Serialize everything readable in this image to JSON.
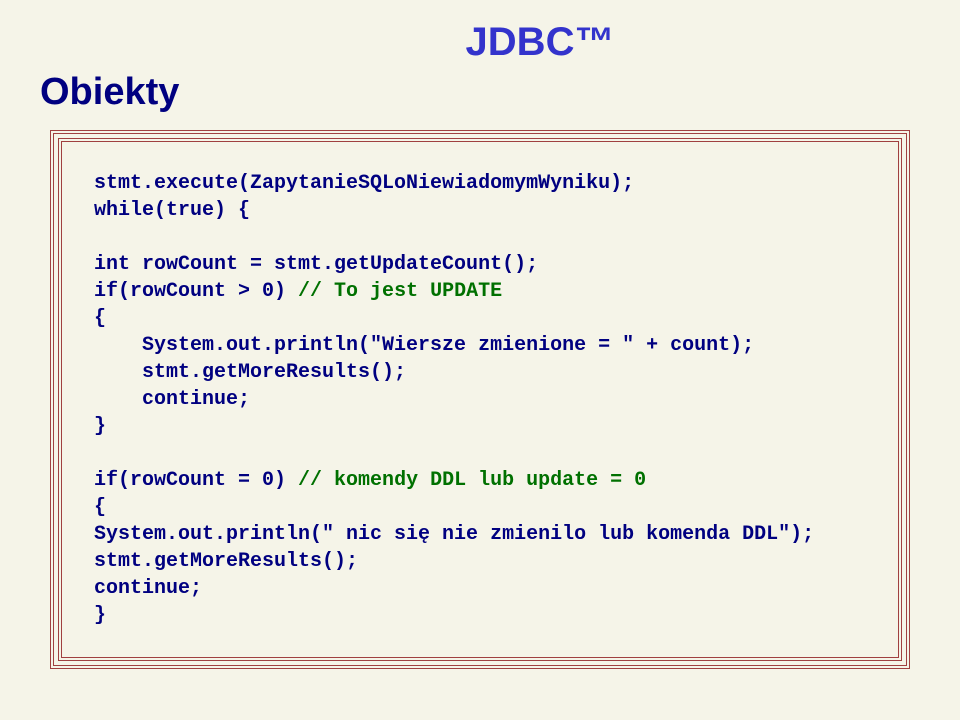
{
  "header": {
    "title": "JDBC™"
  },
  "section": {
    "title": "Obiekty"
  },
  "code": {
    "l1": "stmt.execute(ZapytanieSQLoNiewiadomymWyniku);",
    "l2": "while(true) {",
    "l3": "",
    "l4": "int rowCount = stmt.getUpdateCount();",
    "l5a": "if(rowCount > 0) ",
    "l5b": "// To jest UPDATE",
    "l6": "{",
    "l7": "    System.out.println(\"Wiersze zmienione = \" + count);",
    "l8": "    stmt.getMoreResults();",
    "l9": "    continue;",
    "l10": "}",
    "l11": "",
    "l12a": "if(rowCount = 0) ",
    "l12b": "// komendy DDL lub update = 0",
    "l13": "{",
    "l14": "System.out.println(\" nic się nie zmienilo lub komenda DDL\");",
    "l15": "stmt.getMoreResults();",
    "l16": "continue;",
    "l17": "}"
  }
}
